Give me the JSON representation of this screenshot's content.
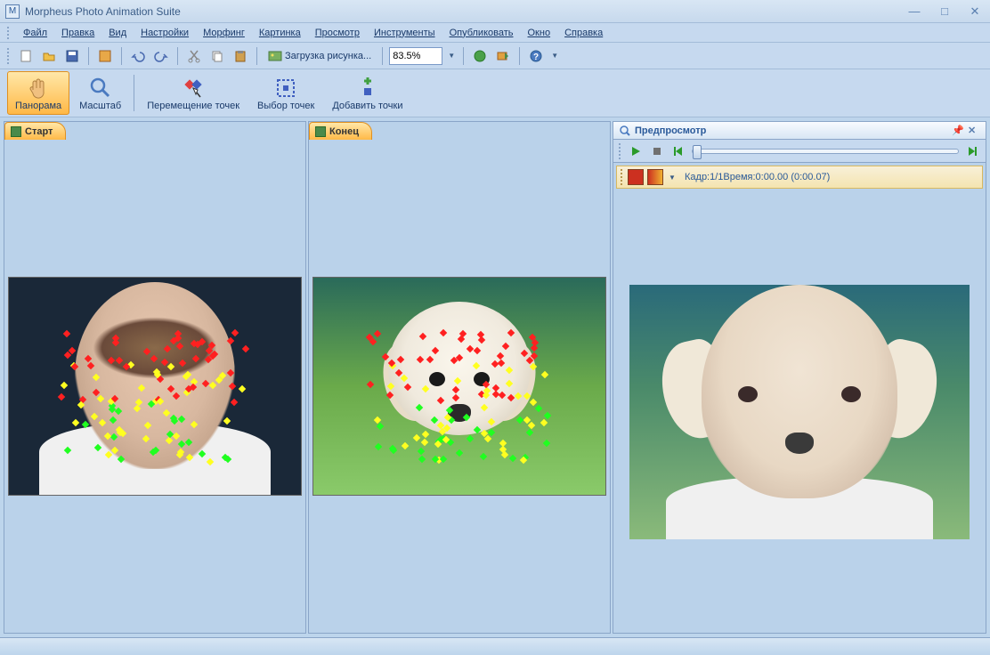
{
  "app": {
    "title": "Morpheus Photo Animation Suite"
  },
  "menu": {
    "file": "Файл",
    "edit": "Правка",
    "view": "Вид",
    "settings": "Настройки",
    "morphing": "Морфинг",
    "picture": "Картинка",
    "browse": "Просмотр",
    "tools": "Инструменты",
    "publish": "Опубликовать",
    "window": "Окно",
    "help": "Справка"
  },
  "toolbar": {
    "load_picture": "Загрузка рисунка...",
    "zoom_value": "83.5%"
  },
  "tools": {
    "panorama": "Панорама",
    "scale": "Масштаб",
    "move_dots": "Перемещение точек",
    "select_dots": "Выбор точек",
    "add_dots": "Добавить точки"
  },
  "panels": {
    "start": "Старт",
    "end": "Конец",
    "preview": "Предпросмотр"
  },
  "preview": {
    "frame_info": "Кадр:1/1Время:0:00.00 (0:00.07)"
  }
}
